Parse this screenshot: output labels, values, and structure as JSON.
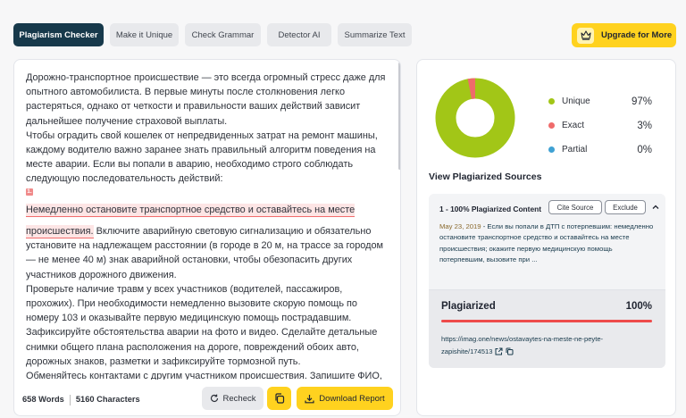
{
  "tabs": [
    {
      "label": "Plagiarism Checker",
      "active": true
    },
    {
      "label": "Make it Unique",
      "active": false
    },
    {
      "label": "Check Grammar",
      "active": false
    },
    {
      "label": "Detector AI",
      "active": false
    },
    {
      "label": "Summarize Text",
      "active": false
    }
  ],
  "upgrade": {
    "label": "Upgrade for More",
    "icon": "crown-icon"
  },
  "editor": {
    "para1": "Дорожно-транспортное происшествие — это всегда огромный стресс даже для опытного автомобилиста. В первые минуты после столкновения легко растеряться, однако от четкости и правильности ваших действий зависит дальнейшее получение страховой выплаты.",
    "para2": "Чтобы оградить свой кошелек от непредвиденных затрат на ремонт машины, каждому водителю важно заранее знать правильный алгоритм поведения на месте аварии. Если вы попали в аварию, необходимо строго соблюдать следующую последовательность действий:",
    "badge": "1.",
    "highlight_line1": "Немедленно остановите транспортное средство и оставайтесь на месте",
    "highlight_line2": "происшествия.",
    "after_highlight": " Включите аварийную световую сигнализацию и обязательно установите на надлежащем расстоянии (в городе в 20 м, на трассе за городом — не менее 40 м) знак аварийной остановки, чтобы обезопасить других участников дорожного движения.",
    "para3": "Проверьте наличие травм у всех участников (водителей, пассажиров, прохожих). При необходимости немедленно вызовите скорую помощь по номеру 103 и оказывайте первую медицинскую помощь пострадавшим.",
    "para4": "Зафиксируйте обстоятельства аварии на фото и видео. Сделайте детальные снимки общего плана расположения на дороге, повреждений обоих авто, дорожных знаков, разметки и зафиксируйте тормозной путь.",
    "para5": "Обменяйтесь контактами с другим участником происшествия. Запишите ФИО, номер телефона другого водителя, государственный номерной знак его автомобиля, а также серию и номер полиса автогражданки."
  },
  "footer": {
    "words": "658 Words",
    "characters": "5160 Characters",
    "recheck_label": "Recheck",
    "download_label": "Download Report"
  },
  "results": {
    "legend": [
      {
        "name": "Unique",
        "pct": "97%",
        "color": "#a2c617"
      },
      {
        "name": "Exact",
        "pct": "3%",
        "color": "#ef6b6b"
      },
      {
        "name": "Partial",
        "pct": "0%",
        "color": "#3fa1d3"
      }
    ],
    "donut": {
      "unique": 0.97,
      "exact": 0.03,
      "partial": 0
    },
    "sources_title": "View Plagiarized Sources",
    "source": {
      "title": "1 - 100% Plagiarized Content",
      "cite_label": "Cite Source",
      "exclude_label": "Exclude",
      "date": "May 23, 2019",
      "snippet": " - Если вы попали в ДТП с потерпевшим: немедленно остановите транспортное средство и оставайтесь на месте происшествия; окажите первую медицинскую помощь потерпевшим, вызовите при ...",
      "status_label": "Plagiarized",
      "status_pct": "100%",
      "status_fraction": 1.0,
      "link": "https://imag.one/news/ostavaytes-na-meste-ne-peyte-zapishite/174513"
    }
  }
}
